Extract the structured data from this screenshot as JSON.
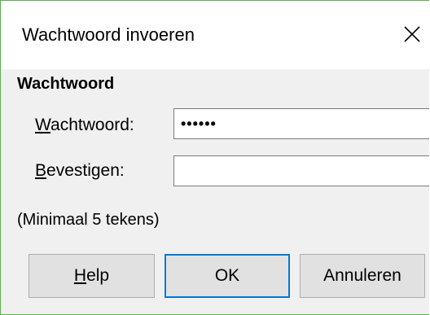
{
  "dialog": {
    "title": "Wachtwoord invoeren",
    "close_icon": "close-icon"
  },
  "section": {
    "heading": "Wachtwoord"
  },
  "fields": {
    "password": {
      "label_mnemonic": "W",
      "label_rest": "achtwoord:",
      "value": "••••••"
    },
    "confirm": {
      "label_mnemonic": "B",
      "label_rest": "evestigen:",
      "value": ""
    }
  },
  "hint": "(Minimaal 5 tekens)",
  "buttons": {
    "help": {
      "mnemonic": "H",
      "rest": "elp"
    },
    "ok": {
      "label": "OK"
    },
    "cancel": {
      "label": "Annuleren"
    }
  },
  "colors": {
    "window_border": "#5ab04c",
    "dialog_background": "#f0f0f0",
    "default_button_border": "#0078d7",
    "button_background": "#e1e1e1"
  }
}
